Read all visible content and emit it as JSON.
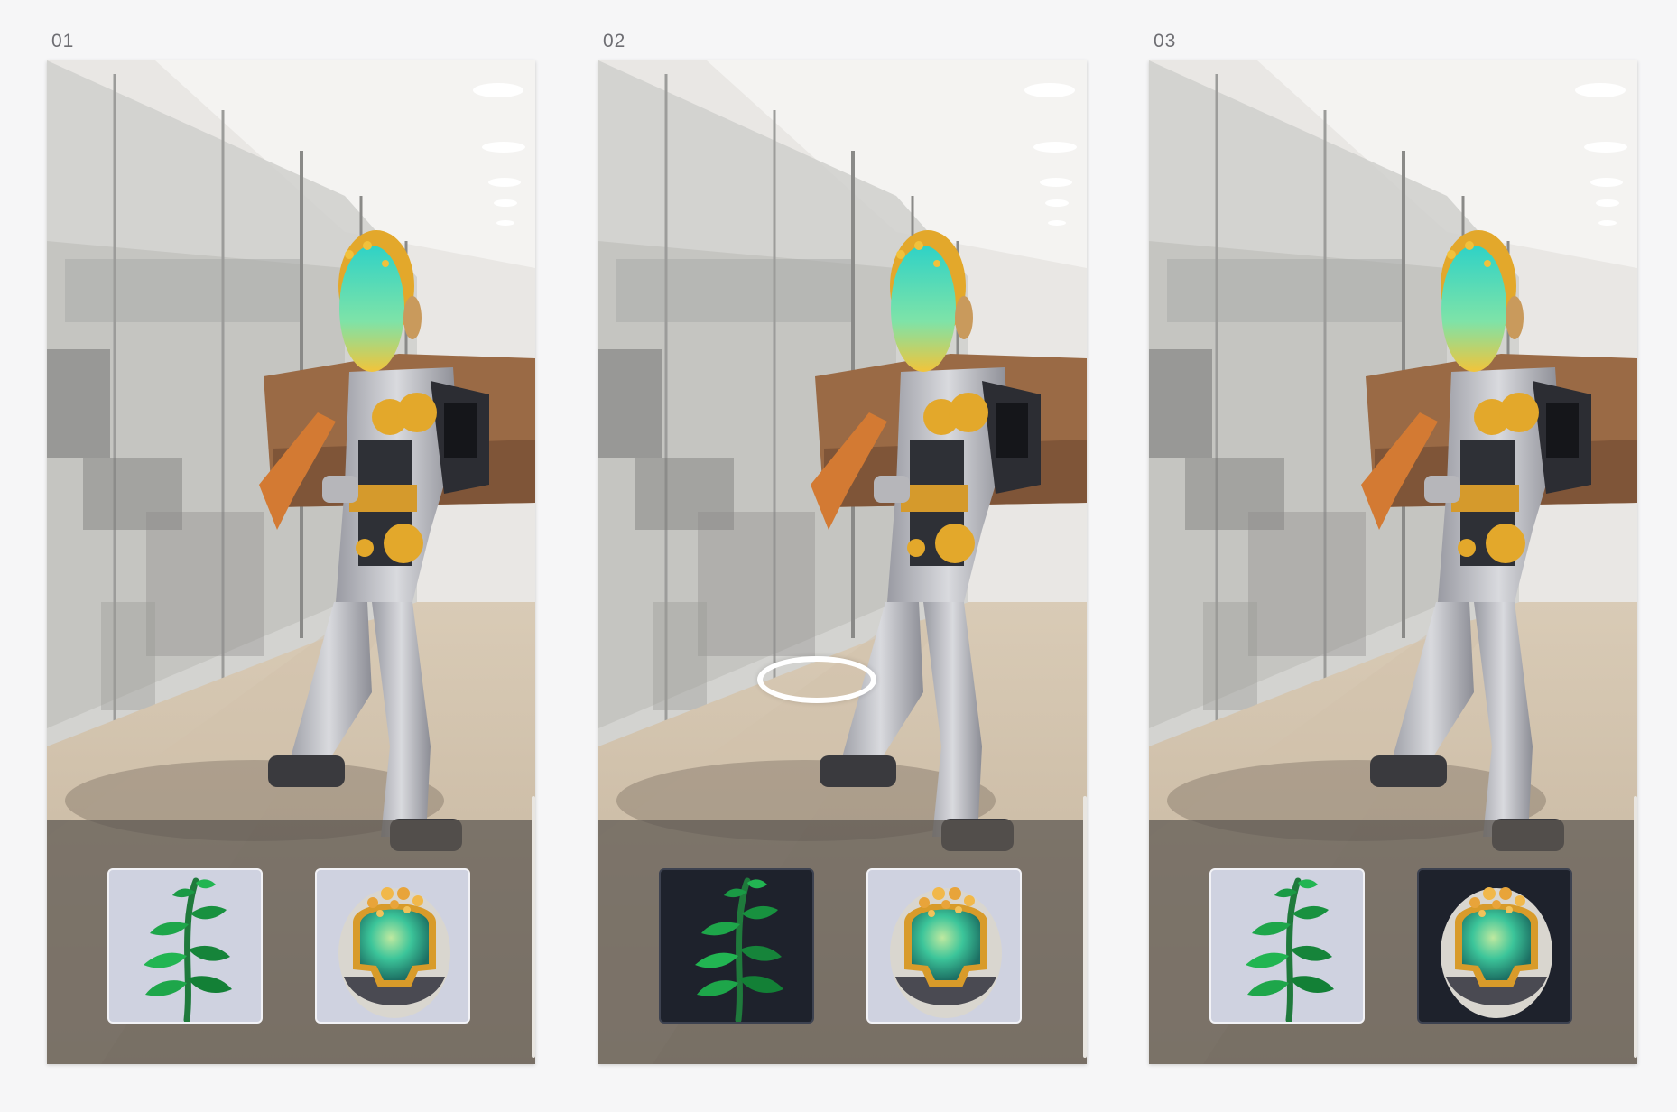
{
  "frames": [
    {
      "label": "01",
      "reticle_visible": false,
      "selected_item": "none"
    },
    {
      "label": "02",
      "reticle_visible": true,
      "selected_item": "plant"
    },
    {
      "label": "03",
      "reticle_visible": false,
      "selected_item": "egg"
    }
  ],
  "tray": {
    "items": [
      {
        "id": "plant",
        "icon": "plant-icon"
      },
      {
        "id": "egg",
        "icon": "egg-icon"
      }
    ]
  },
  "colors": {
    "page_background": "#f6f6f7",
    "tile_default": "#cfd2e0",
    "tile_selected": "#1e222c",
    "tray_overlay": "#5c5650",
    "reticle": "#ffffff",
    "character_face": "#33d6b8",
    "character_gold": "#e0a52a"
  }
}
